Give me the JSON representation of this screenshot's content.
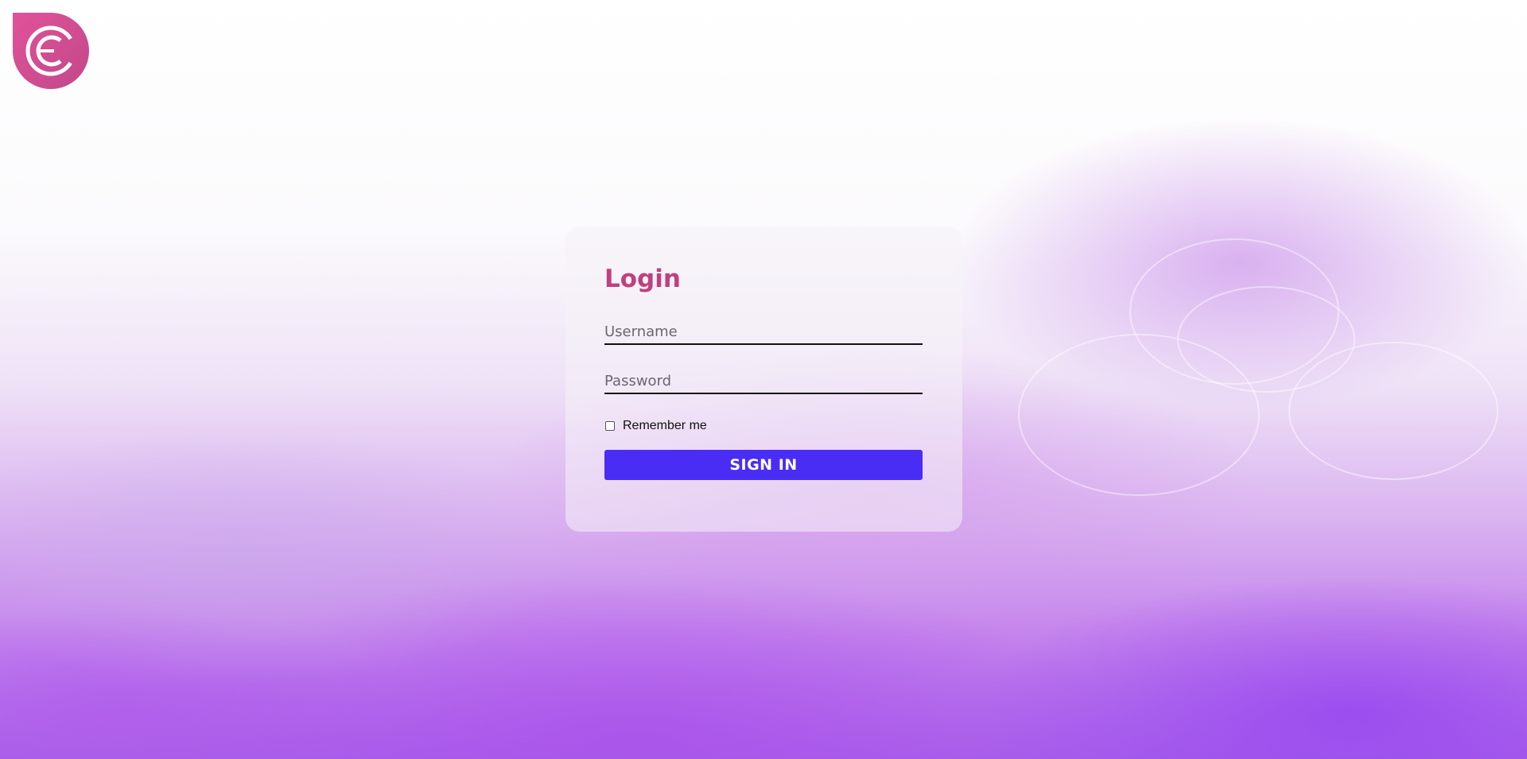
{
  "logo": {
    "icon": "euro-circle-icon",
    "color": "#d24b91"
  },
  "login": {
    "title": "Login",
    "username_placeholder": "Username",
    "password_placeholder": "Password",
    "remember_label": "Remember me",
    "signin_label": "SIGN IN"
  },
  "colors": {
    "title": "#c0407d",
    "button": "#4a2df5"
  }
}
